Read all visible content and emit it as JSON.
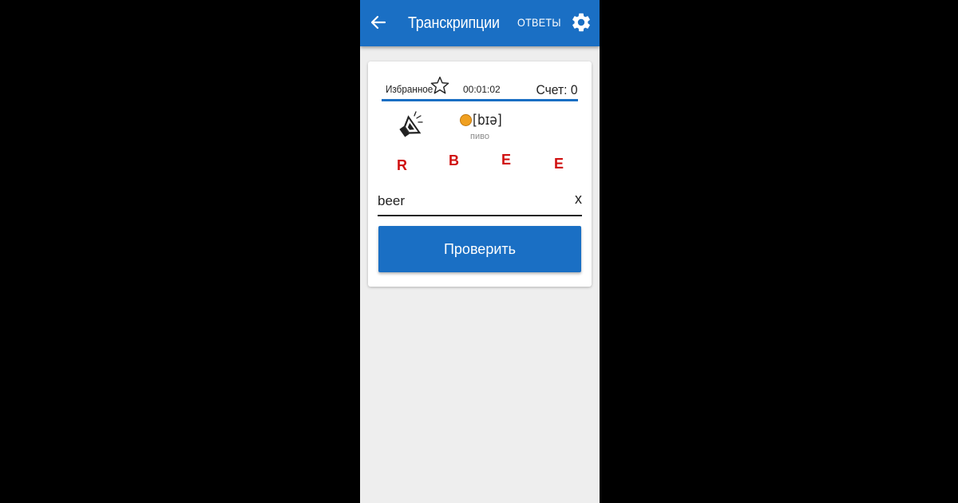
{
  "app_bar": {
    "title": "Транскрипции",
    "answers_label": "ОТВЕТЫ",
    "back_icon": "arrow-left-icon",
    "settings_icon": "gear-icon",
    "color": "#1a6fc4"
  },
  "card": {
    "favorite_label": "Избранное",
    "favorite_icon": "star-outline-icon",
    "timer": "00:01:02",
    "score_label": "Счет: 0",
    "speaker_icon": "speaker-icon",
    "status_dot_color": "#f0a020",
    "transcription": "[bɪə]",
    "translation": "пиво",
    "letters": [
      "R",
      "B",
      "E",
      "E"
    ],
    "letter_color": "#d01010",
    "answer_value": "beer",
    "clear_label": "x",
    "check_label": "Проверить"
  }
}
